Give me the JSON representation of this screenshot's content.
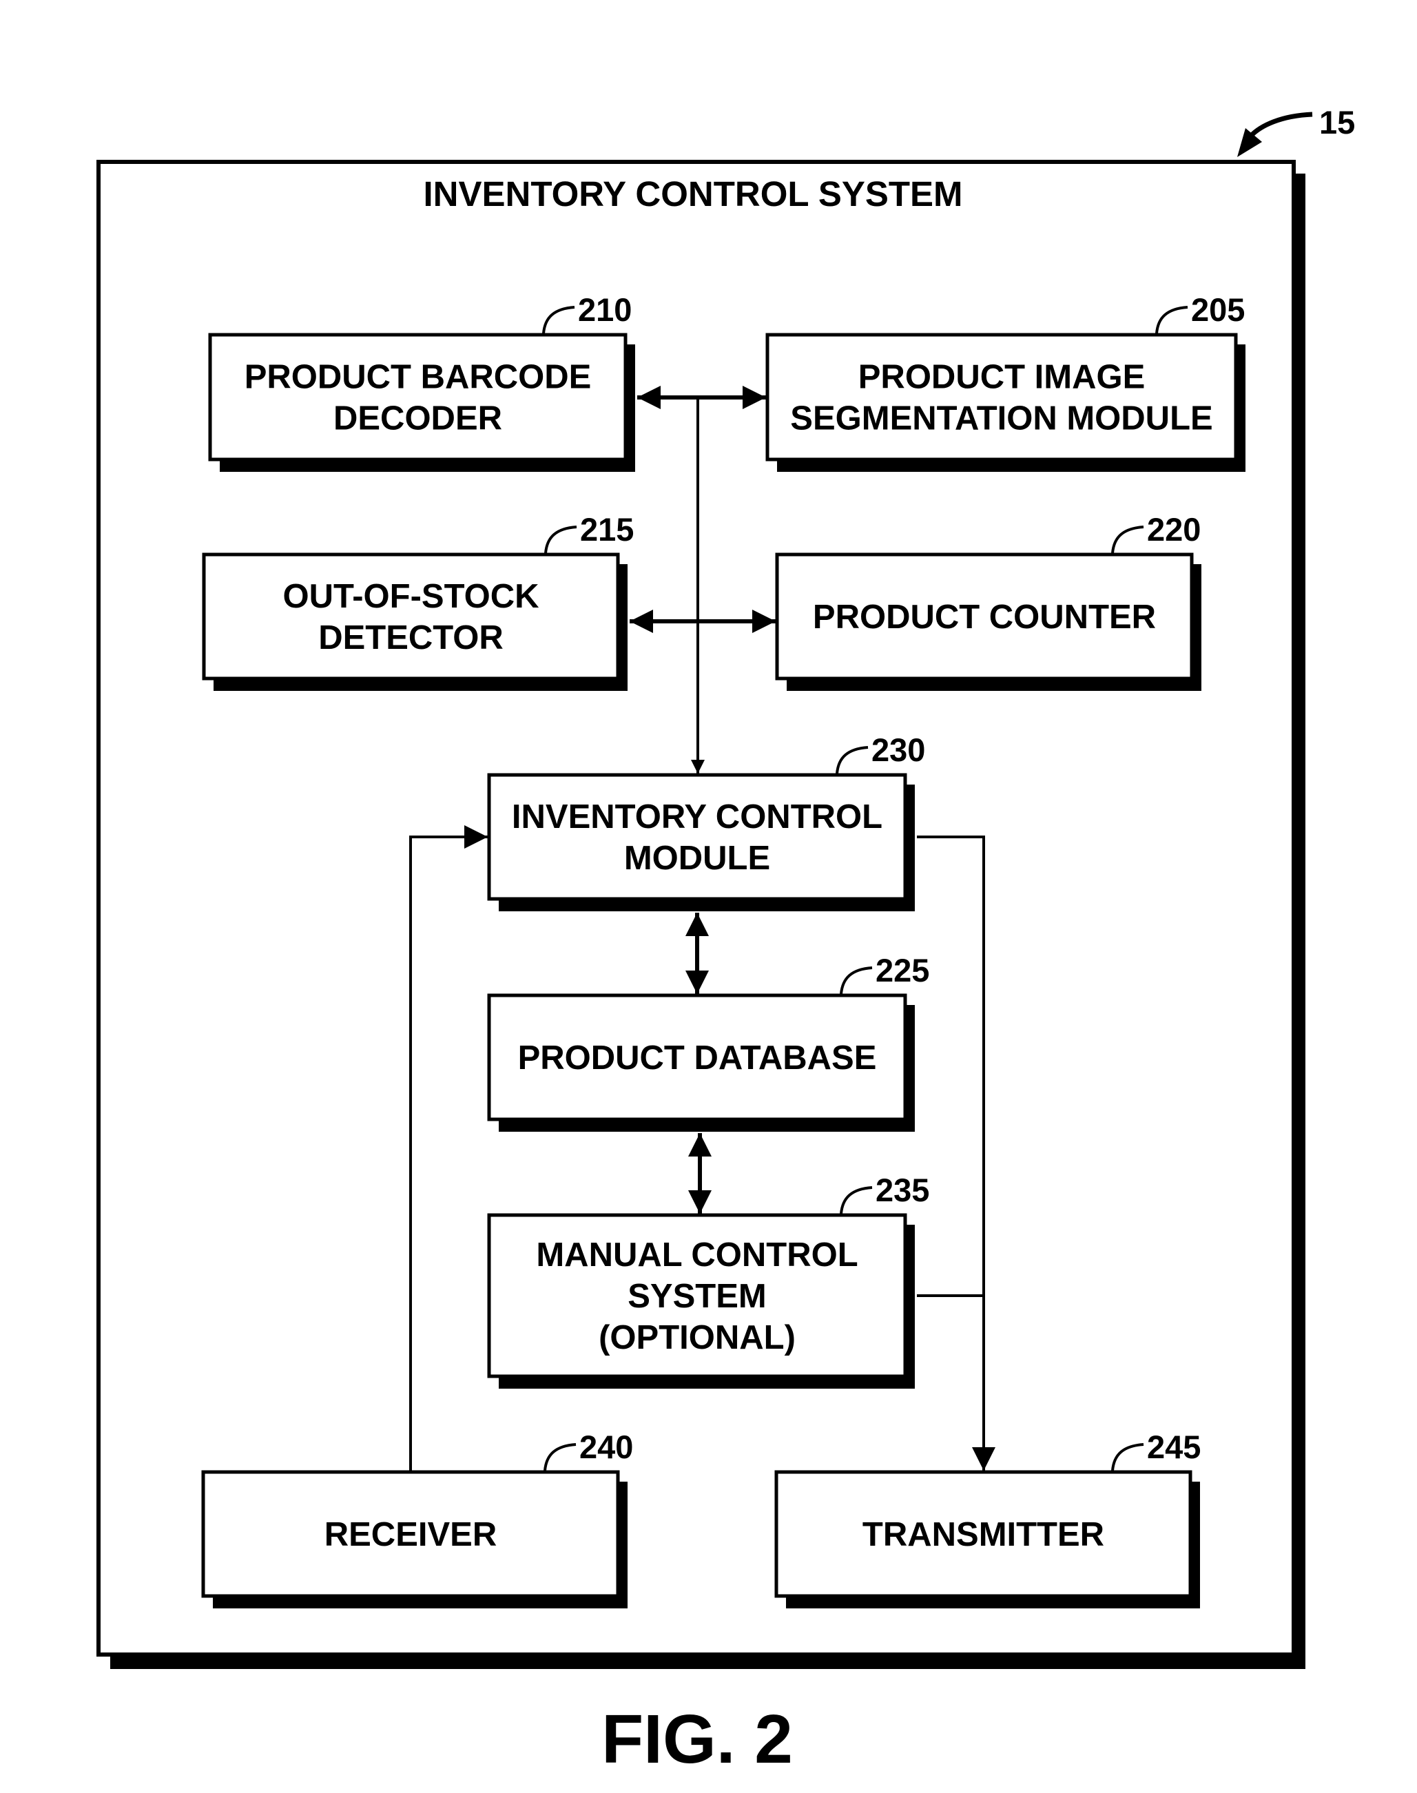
{
  "figure": {
    "label": "FIG. 2",
    "reference": "15",
    "system_title": "INVENTORY CONTROL SYSTEM"
  },
  "blocks": {
    "barcode_decoder": {
      "ref": "210",
      "lines": [
        "PRODUCT BARCODE",
        "DECODER"
      ]
    },
    "image_segmentation": {
      "ref": "205",
      "lines": [
        "PRODUCT IMAGE",
        "SEGMENTATION MODULE"
      ]
    },
    "out_of_stock": {
      "ref": "215",
      "lines": [
        "OUT-OF-STOCK",
        "DETECTOR"
      ]
    },
    "product_counter": {
      "ref": "220",
      "lines": [
        "PRODUCT COUNTER"
      ]
    },
    "inventory_control_module": {
      "ref": "230",
      "lines": [
        "INVENTORY CONTROL",
        "MODULE"
      ]
    },
    "product_database": {
      "ref": "225",
      "lines": [
        "PRODUCT DATABASE"
      ]
    },
    "manual_control": {
      "ref": "235",
      "lines": [
        "MANUAL CONTROL",
        "SYSTEM",
        "(OPTIONAL)"
      ]
    },
    "receiver": {
      "ref": "240",
      "lines": [
        "RECEIVER"
      ]
    },
    "transmitter": {
      "ref": "245",
      "lines": [
        "TRANSMITTER"
      ]
    }
  },
  "connections": [
    {
      "from": "barcode_decoder",
      "to": "image_segmentation",
      "type": "bidirectional"
    },
    {
      "from": "out_of_stock",
      "to": "product_counter",
      "type": "bidirectional"
    },
    {
      "from": "bus",
      "to": "inventory_control_module",
      "type": "directed"
    },
    {
      "from": "inventory_control_module",
      "to": "product_database",
      "type": "bidirectional"
    },
    {
      "from": "product_database",
      "to": "manual_control",
      "type": "bidirectional"
    },
    {
      "from": "receiver",
      "to": "inventory_control_module",
      "type": "directed"
    },
    {
      "from": "inventory_control_module",
      "to": "transmitter",
      "type": "directed"
    },
    {
      "from": "manual_control",
      "to": "transmitter",
      "type": "directed"
    }
  ]
}
